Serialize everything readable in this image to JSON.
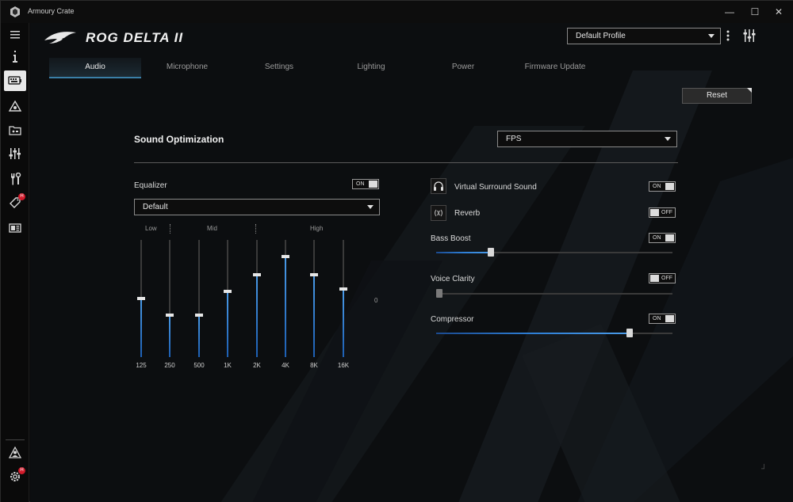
{
  "window": {
    "app_title": "Armoury Crate",
    "controls": {
      "minimize": "—",
      "maximize": "☐",
      "close": "✕"
    }
  },
  "sidebar": {
    "items": [
      {
        "name": "menu-icon",
        "glyph": "☰"
      },
      {
        "name": "info-icon",
        "glyph": "i"
      },
      {
        "name": "device-icon",
        "active": true
      },
      {
        "name": "aura-icon"
      },
      {
        "name": "game-library-icon"
      },
      {
        "name": "mixer-icon"
      },
      {
        "name": "tools-icon"
      },
      {
        "name": "deals-icon",
        "badge": "H"
      },
      {
        "name": "news-icon"
      }
    ],
    "bottom": [
      {
        "name": "user-icon"
      },
      {
        "name": "settings-icon",
        "badge": "H"
      }
    ]
  },
  "header": {
    "product": "ROG DELTA II",
    "profile": "Default Profile"
  },
  "tabs": [
    {
      "label": "Audio",
      "active": true
    },
    {
      "label": "Microphone"
    },
    {
      "label": "Settings"
    },
    {
      "label": "Lighting"
    },
    {
      "label": "Power"
    },
    {
      "label": "Firmware Update"
    }
  ],
  "reset_label": "Reset",
  "sound_optimization": {
    "title": "Sound Optimization",
    "mode": "FPS"
  },
  "equalizer": {
    "label": "Equalizer",
    "toggle": "ON",
    "preset": "Default",
    "groups": [
      "Low",
      "Mid",
      "High"
    ],
    "zero_label": "0",
    "bands": [
      {
        "label": "125",
        "level": 0.5
      },
      {
        "label": "250",
        "level": 0.36
      },
      {
        "label": "500",
        "level": 0.36
      },
      {
        "label": "1K",
        "level": 0.56
      },
      {
        "label": "2K",
        "level": 0.7
      },
      {
        "label": "4K",
        "level": 0.86
      },
      {
        "label": "8K",
        "level": 0.7
      },
      {
        "label": "16K",
        "level": 0.58
      }
    ]
  },
  "features": {
    "virtual_surround": {
      "label": "Virtual Surround Sound",
      "toggle": "ON"
    },
    "reverb": {
      "label": "Reverb",
      "toggle": "OFF"
    },
    "bass_boost": {
      "label": "Bass Boost",
      "toggle": "ON",
      "level": 0.23
    },
    "voice_clarity": {
      "label": "Voice Clarity",
      "toggle": "OFF",
      "level": 0.0
    },
    "compressor": {
      "label": "Compressor",
      "toggle": "ON",
      "level": 0.82
    }
  },
  "colors": {
    "accent": "#2e7fd6",
    "tab_underline": "#3a7fa8",
    "badge": "#d01a2a"
  }
}
